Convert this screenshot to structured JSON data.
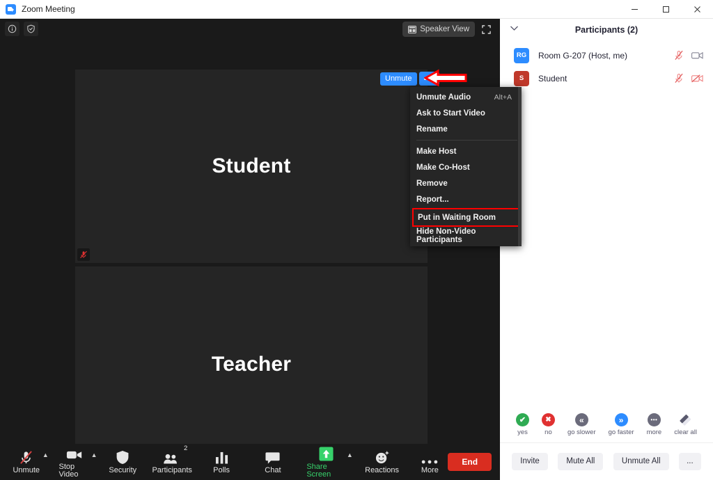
{
  "window": {
    "title": "Zoom Meeting",
    "logo_icon": "zoom-logo-icon",
    "minimize_label": "Minimize",
    "maximize_label": "Maximize",
    "close_label": "Close"
  },
  "meeting": {
    "info_icon": "info-icon",
    "security_shield_icon": "shield-check-icon",
    "view_button": {
      "label": "Speaker View",
      "icon": "layout-icon"
    },
    "fullscreen_icon": "fullscreen-icon",
    "tiles": [
      {
        "name": "Student",
        "muted": true,
        "mute_icon": "mic-muted-icon"
      },
      {
        "name": "Teacher",
        "muted": true,
        "mute_icon": "mic-muted-icon"
      }
    ],
    "hover_controls": {
      "unmute_label": "Unmute",
      "more_label": "•••"
    },
    "annotation": {
      "type": "red-arrow",
      "color": "#ff0000",
      "points_to": "more-options-button"
    }
  },
  "context_menu": {
    "highlight_color": "#ff0000",
    "items": [
      {
        "label": "Unmute Audio",
        "shortcut": "Alt+A",
        "highlighted": false,
        "separator_after": false
      },
      {
        "label": "Ask to Start Video",
        "shortcut": "",
        "highlighted": false,
        "separator_after": false
      },
      {
        "label": "Rename",
        "shortcut": "",
        "highlighted": false,
        "separator_after": true
      },
      {
        "label": "Make Host",
        "shortcut": "",
        "highlighted": false,
        "separator_after": false
      },
      {
        "label": "Make Co-Host",
        "shortcut": "",
        "highlighted": false,
        "separator_after": false
      },
      {
        "label": "Remove",
        "shortcut": "",
        "highlighted": false,
        "separator_after": false
      },
      {
        "label": "Report...",
        "shortcut": "",
        "highlighted": false,
        "separator_after": false
      },
      {
        "label": "Put in Waiting Room",
        "shortcut": "",
        "highlighted": true,
        "separator_after": false
      },
      {
        "label": "Hide Non-Video Participants",
        "shortcut": "",
        "highlighted": false,
        "separator_after": false
      }
    ]
  },
  "toolbar": {
    "items": [
      {
        "label": "Unmute",
        "icon": "mic-muted-icon",
        "caret": true,
        "badge": "",
        "accent": ""
      },
      {
        "label": "Stop Video",
        "icon": "video-icon",
        "caret": true,
        "badge": "",
        "accent": ""
      },
      {
        "label": "Security",
        "icon": "shield-icon",
        "caret": false,
        "badge": "",
        "accent": ""
      },
      {
        "label": "Participants",
        "icon": "participants-icon",
        "caret": false,
        "badge": "2",
        "accent": ""
      },
      {
        "label": "Polls",
        "icon": "polls-icon",
        "caret": false,
        "badge": "",
        "accent": ""
      },
      {
        "label": "Chat",
        "icon": "chat-icon",
        "caret": false,
        "badge": "",
        "accent": ""
      },
      {
        "label": "Share Screen",
        "icon": "share-screen-icon",
        "caret": true,
        "badge": "",
        "accent": "#37d26b"
      },
      {
        "label": "Reactions",
        "icon": "reactions-icon",
        "caret": false,
        "badge": "",
        "accent": ""
      },
      {
        "label": "More",
        "icon": "more-dots-icon",
        "caret": false,
        "badge": "",
        "accent": ""
      }
    ],
    "end_button": {
      "label": "End",
      "color": "#d92d20"
    }
  },
  "participants_panel": {
    "collapse_icon": "chevron-down-icon",
    "title": "Participants (2)",
    "rows": [
      {
        "initials": "RG",
        "avatar_color": "#2d8cff",
        "name": "Room G-207 (Host, me)",
        "mic_icon": "mic-muted-icon",
        "mic_muted": true,
        "video_icon": "video-icon",
        "video_off": false
      },
      {
        "initials": "S",
        "avatar_color": "#c0392b",
        "name": "Student",
        "mic_icon": "mic-muted-icon",
        "mic_muted": true,
        "video_icon": "video-off-icon",
        "video_off": true
      }
    ],
    "reactions": [
      {
        "label": "yes",
        "icon": "check-icon",
        "color": "#2fab53",
        "glyph": "✔"
      },
      {
        "label": "no",
        "icon": "cross-icon",
        "color": "#e03131",
        "glyph": "✖"
      },
      {
        "label": "go slower",
        "icon": "rewind-icon",
        "color": "#6b6b7b",
        "glyph": "«"
      },
      {
        "label": "go faster",
        "icon": "fast-forward-icon",
        "color": "#2d8cff",
        "glyph": "»"
      },
      {
        "label": "more",
        "icon": "more-dots-icon",
        "color": "#6b6b7b",
        "glyph": "•••"
      },
      {
        "label": "clear all",
        "icon": "eraser-icon",
        "color": "#5a5a6e",
        "glyph": ""
      }
    ],
    "actions": [
      {
        "label": "Invite"
      },
      {
        "label": "Mute All"
      },
      {
        "label": "Unmute All"
      },
      {
        "label": "..."
      }
    ]
  }
}
